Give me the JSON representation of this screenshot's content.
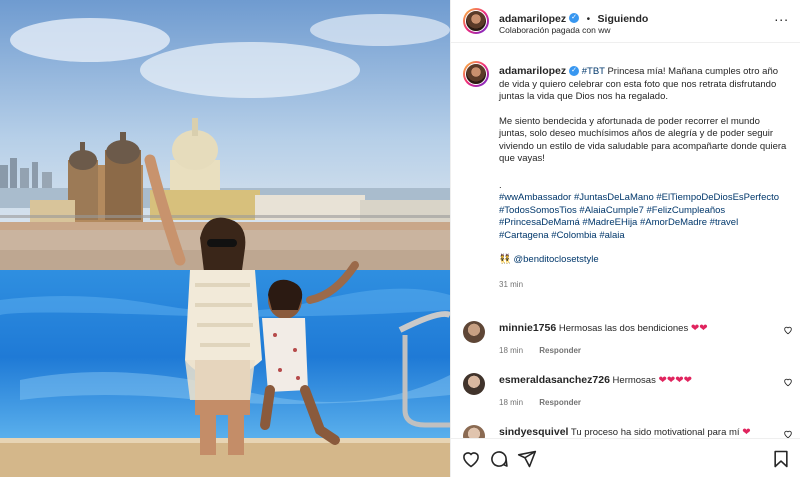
{
  "post": {
    "author": "adamarilopez",
    "follow_status": "Siguiendo",
    "separator": "•",
    "subtitle": "Colaboración pagada con ww",
    "more_label": "...",
    "caption_author": "adamarilopez",
    "caption_tag": "#TBT",
    "caption_p1": "Princesa mía! Mañana cumples otro año de vida y quiero celebrar con esta foto que nos retrata disfrutando juntas la vida que Dios nos ha regalado.",
    "caption_p2": "Me siento bendecida y afortunada de poder recorrer el mundo juntas, solo deseo muchísimos años de alegría y de poder seguir viviendo un estilo de vida saludable para acompañarte donde quiera que vayas!",
    "caption_dot": ".",
    "hashtags": "#wwAmbassador #JuntasDeLaMano #ElTiempoDeDiosEsPerfecto #TodosSomosTios #AlaiaCumple7 #FelizCumpleaños #PrincesaDeMamá #MadreEHija #AmorDeMadre #travel #Cartagena #Colombia #alaia",
    "mention": "@benditoclosetstyle",
    "mention_emoji": "👯",
    "time": "31 min"
  },
  "comments": [
    {
      "user": "minnie1756",
      "text": "Hermosas las dos bendiciones",
      "hearts": "❤❤",
      "time": "18 min",
      "reply": "Responder"
    },
    {
      "user": "esmeraldasanchez726",
      "text": "Hermosas",
      "hearts": "❤❤❤❤",
      "time": "18 min",
      "reply": "Responder"
    },
    {
      "user": "sindyesquivel",
      "text": "Tu proceso ha sido motivational para mí",
      "hearts": "❤",
      "time": "",
      "reply": ""
    }
  ],
  "icons": {
    "like": "heart-outline-icon",
    "comment": "comment-bubble-icon",
    "share": "paper-plane-icon",
    "save": "bookmark-icon",
    "verified": "verified-badge-icon",
    "colors": {
      "verified": "#3897f0",
      "link": "#00376b",
      "heart": "#e0245e",
      "muted": "#737373"
    }
  }
}
